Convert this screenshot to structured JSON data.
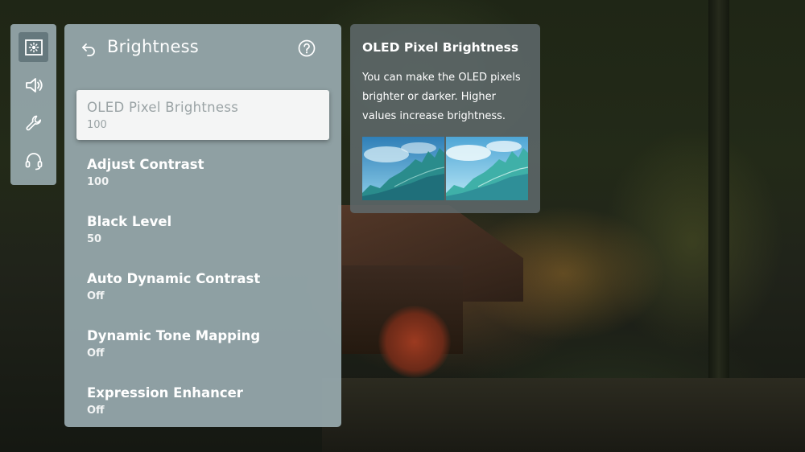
{
  "rail": {
    "items": [
      {
        "icon": "picture-settings-icon",
        "selected": true
      },
      {
        "icon": "speaker-icon",
        "selected": false
      },
      {
        "icon": "wrench-icon",
        "selected": false
      },
      {
        "icon": "headset-icon",
        "selected": false
      }
    ]
  },
  "panel": {
    "title": "Brightness",
    "back_icon": "back-arrow-icon",
    "help_icon": "help-icon",
    "items": [
      {
        "label": "OLED Pixel Brightness",
        "value": "100"
      },
      {
        "label": "Adjust Contrast",
        "value": "100"
      },
      {
        "label": "Black Level",
        "value": "50"
      },
      {
        "label": "Auto Dynamic Contrast",
        "value": "Off"
      },
      {
        "label": "Dynamic Tone Mapping",
        "value": "Off"
      },
      {
        "label": "Expression Enhancer",
        "value": "Off"
      }
    ]
  },
  "info": {
    "title": "OLED Pixel Brightness",
    "description": "You can make the OLED pixels brighter or darker. Higher values increase brightness."
  },
  "colors": {
    "panel_bg": "#96a8ac",
    "focused_bg": "#f4f5f5",
    "focused_text": "#9aa3a5",
    "info_bg": "#606a6c"
  }
}
